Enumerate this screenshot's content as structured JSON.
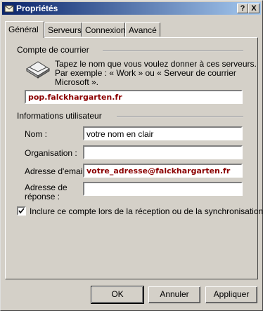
{
  "window": {
    "title": "Propriétés"
  },
  "titlebar_buttons": {
    "help": "?",
    "close": "X"
  },
  "tabs": [
    {
      "label": "Général",
      "active": true
    },
    {
      "label": "Serveurs",
      "active": false
    },
    {
      "label": "Connexion",
      "active": false
    },
    {
      "label": "Avancé",
      "active": false
    }
  ],
  "mail_account": {
    "group_label": "Compte de courrier",
    "description_line1": "Tapez le nom que vous voulez donner à ces serveurs.",
    "description_line2": "Par exemple : « Work » ou « Serveur de courrier",
    "description_line3": "Microsoft ».",
    "account_name": "pop.falckhargarten.fr",
    "icon": "mail-server-icon"
  },
  "user_info": {
    "group_label": "Informations utilisateur",
    "name_label": "Nom :",
    "name_value": "votre nom en clair",
    "organisation_label": "Organisation :",
    "organisation_value": "",
    "email_label": "Adresse d'email :",
    "email_value": "votre_adresse@falckhargarten.fr",
    "reply_label_line1": "Adresse de",
    "reply_label_line2": "réponse :",
    "reply_value": ""
  },
  "include_account": {
    "label": "Inclure ce compte lors de la réception ou de la synchronisation",
    "checked": true
  },
  "buttons": {
    "ok": "OK",
    "cancel": "Annuler",
    "apply": "Appliquer"
  }
}
